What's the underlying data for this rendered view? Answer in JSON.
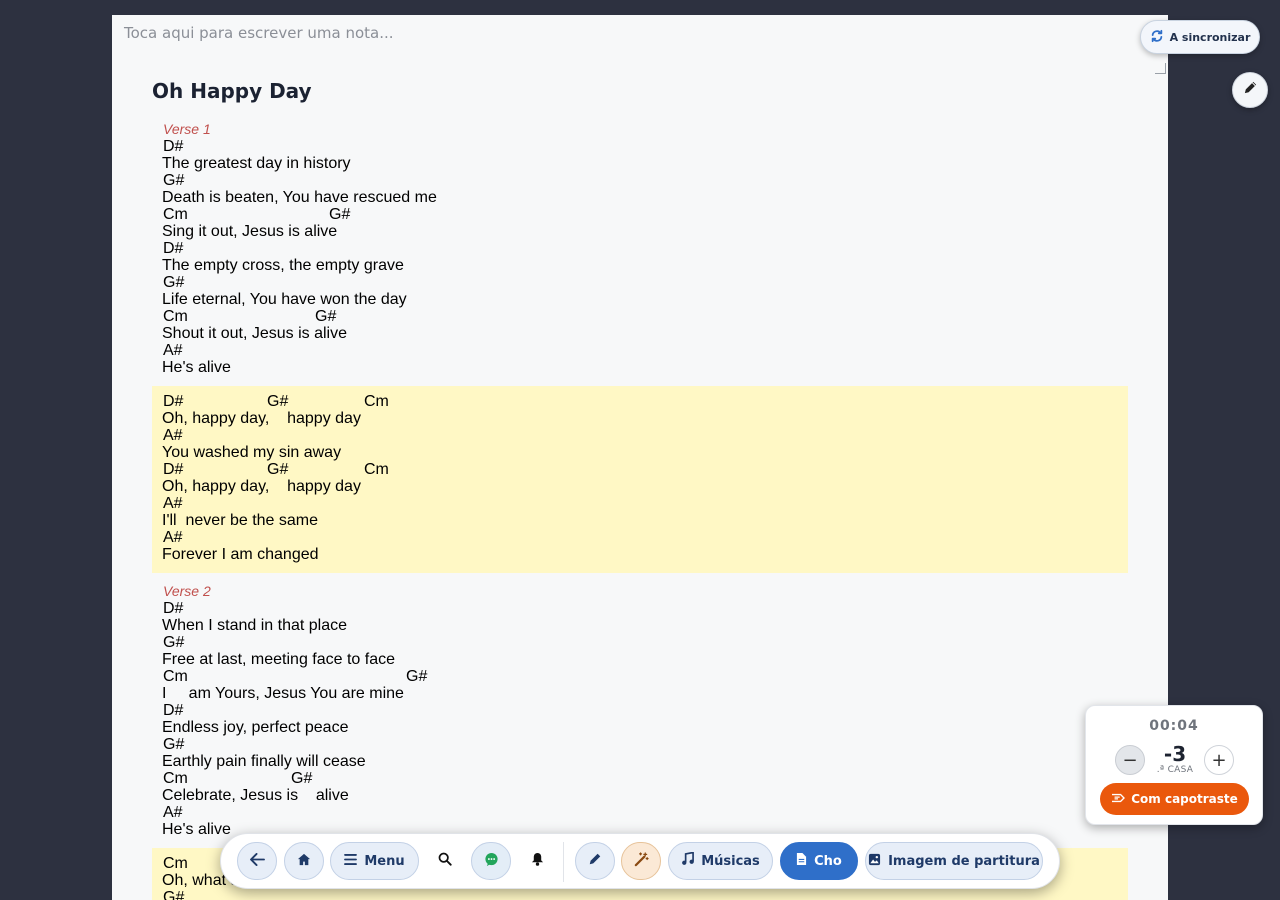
{
  "note": {
    "placeholder": "Toca aqui para escrever uma nota..."
  },
  "sync": {
    "label": "A sincronizar"
  },
  "song": {
    "title": "Oh Happy Day",
    "sections": [
      {
        "label": "Verse 1",
        "type": "verse",
        "lines": [
          {
            "chords": [
              {
                "text": "D#",
                "pos": 0
              }
            ],
            "lyric": "The greatest day in history"
          },
          {
            "chords": [
              {
                "text": "G#",
                "pos": 0
              }
            ],
            "lyric": "Death is beaten, You have rescued me"
          },
          {
            "chords": [
              {
                "text": "Cm",
                "pos": 0
              },
              {
                "text": "G#",
                "pos": 166
              }
            ],
            "lyric": "Sing it out, Jesus is alive"
          },
          {
            "chords": [
              {
                "text": "D#",
                "pos": 0
              }
            ],
            "lyric": "The empty cross, the empty grave"
          },
          {
            "chords": [
              {
                "text": "G#",
                "pos": 0
              }
            ],
            "lyric": "Life eternal, You have won the day"
          },
          {
            "chords": [
              {
                "text": "Cm",
                "pos": 0
              },
              {
                "text": "G#",
                "pos": 152
              }
            ],
            "lyric": "Shout it out, Jesus is alive"
          },
          {
            "chords": [
              {
                "text": "A#",
                "pos": 0
              }
            ],
            "lyric": "He's alive"
          }
        ]
      },
      {
        "label": "",
        "type": "chorus",
        "lines": [
          {
            "chords": [
              {
                "text": "D#",
                "pos": 0
              },
              {
                "text": "G#",
                "pos": 104
              },
              {
                "text": "Cm",
                "pos": 201
              }
            ],
            "lyric": "Oh, happy day,    happy day"
          },
          {
            "chords": [
              {
                "text": "A#",
                "pos": 0
              }
            ],
            "lyric": "You washed my sin away"
          },
          {
            "chords": [
              {
                "text": "D#",
                "pos": 0
              },
              {
                "text": "G#",
                "pos": 104
              },
              {
                "text": "Cm",
                "pos": 201
              }
            ],
            "lyric": "Oh, happy day,    happy day"
          },
          {
            "chords": [
              {
                "text": "A#",
                "pos": 0
              }
            ],
            "lyric": "I'll  never be the same"
          },
          {
            "chords": [
              {
                "text": "A#",
                "pos": 0
              }
            ],
            "lyric": "Forever I am changed"
          }
        ]
      },
      {
        "label": "Verse 2",
        "type": "verse",
        "lines": [
          {
            "chords": [
              {
                "text": "D#",
                "pos": 0
              }
            ],
            "lyric": "When I stand in that place"
          },
          {
            "chords": [
              {
                "text": "G#",
                "pos": 0
              }
            ],
            "lyric": "Free at last, meeting face to face"
          },
          {
            "chords": [
              {
                "text": "Cm",
                "pos": 0
              },
              {
                "text": "G#",
                "pos": 243
              }
            ],
            "lyric": "I     am Yours, Jesus You are mine"
          },
          {
            "chords": [
              {
                "text": "D#",
                "pos": 0
              }
            ],
            "lyric": "Endless joy, perfect peace"
          },
          {
            "chords": [
              {
                "text": "G#",
                "pos": 0
              }
            ],
            "lyric": "Earthly pain finally will cease"
          },
          {
            "chords": [
              {
                "text": "Cm",
                "pos": 0
              },
              {
                "text": "G#",
                "pos": 128
              }
            ],
            "lyric": "Celebrate, Jesus is    alive"
          },
          {
            "chords": [
              {
                "text": "A#",
                "pos": 0
              }
            ],
            "lyric": "He's alive"
          }
        ]
      },
      {
        "label": "",
        "type": "chorus",
        "lines": [
          {
            "chords": [
              {
                "text": "Cm",
                "pos": 0
              }
            ],
            "lyric": "Oh, what a glorious day"
          },
          {
            "chords": [
              {
                "text": "G#",
                "pos": 0
              }
            ],
            "lyric": ""
          }
        ]
      }
    ]
  },
  "capo": {
    "timer": "00:04",
    "value": "-3",
    "unit": ".ª CASA",
    "minus": "−",
    "plus": "+",
    "button_label": "Com capotraste"
  },
  "toolbar": {
    "menu_label": "Menu",
    "songs_label": "Músicas",
    "cho_label": "Cho",
    "sheet_label": "Imagem de partitura"
  },
  "colors": {
    "background": "#2d3140",
    "chorus_highlight": "#fff8c5",
    "section_label": "#c0504d",
    "accent_blue": "#2f6fc9",
    "accent_orange": "#ea580c"
  }
}
